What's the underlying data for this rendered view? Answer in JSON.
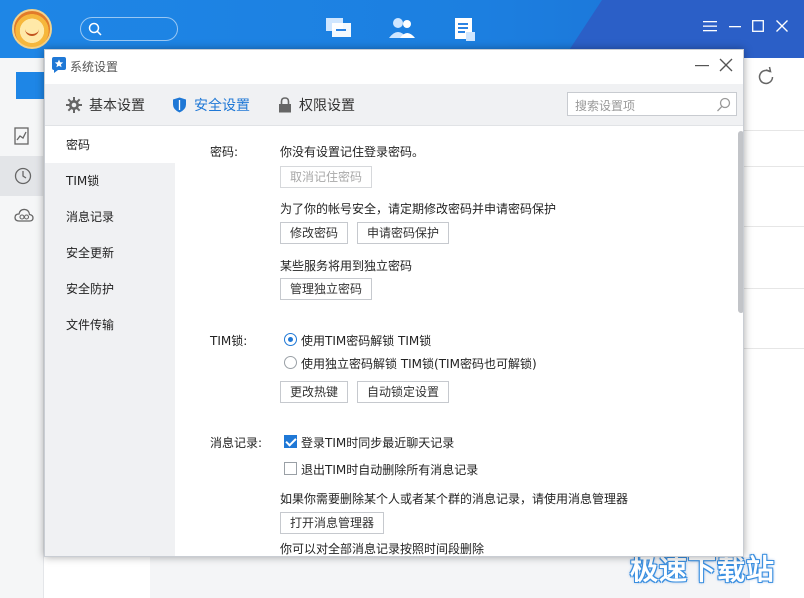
{
  "background_window": {
    "nav_icons": [
      "chat-bubble-icon",
      "contacts-icon",
      "docs-icon"
    ],
    "left_icons": [
      "chart-icon",
      "clock-icon",
      "cloud-icon"
    ],
    "watermark": "极速下载站"
  },
  "dialog": {
    "title": "系统设置",
    "tabs": [
      {
        "label": "基本设置",
        "icon": "gear-icon"
      },
      {
        "label": "安全设置",
        "icon": "shield-icon"
      },
      {
        "label": "权限设置",
        "icon": "lock-icon"
      }
    ],
    "active_tab": "安全设置",
    "search_placeholder": "搜索设置项"
  },
  "sidenav": {
    "items": [
      "密码",
      "TIM锁",
      "消息记录",
      "安全更新",
      "安全防护",
      "文件传输"
    ],
    "active": "密码"
  },
  "password": {
    "label": "密码:",
    "status": "你没有设置记住登录密码。",
    "cancel_remember": "取消记住密码",
    "advice": "为了你的帐号安全，请定期修改密码并申请密码保护",
    "change_pw": "修改密码",
    "apply_protect": "申请密码保护",
    "independent_note": "某些服务将用到独立密码",
    "manage_independent": "管理独立密码"
  },
  "timlock": {
    "label": "TIM锁:",
    "option1": "使用TIM密码解锁 TIM锁",
    "option2": "使用独立密码解锁 TIM锁(TIM密码也可解锁)",
    "selected": 1,
    "hotkey": "更改热键",
    "autolock": "自动锁定设置"
  },
  "msgrecord": {
    "label": "消息记录:",
    "sync": "登录TIM时同步最近聊天记录",
    "sync_checked": true,
    "auto_delete": "退出TIM时自动删除所有消息记录",
    "auto_delete_checked": false,
    "manager_note": "如果你需要删除某个人或者某个群的消息记录，请使用消息管理器",
    "open_manager": "打开消息管理器",
    "time_delete_note": "你可以对全部消息记录按照时间段删除"
  }
}
